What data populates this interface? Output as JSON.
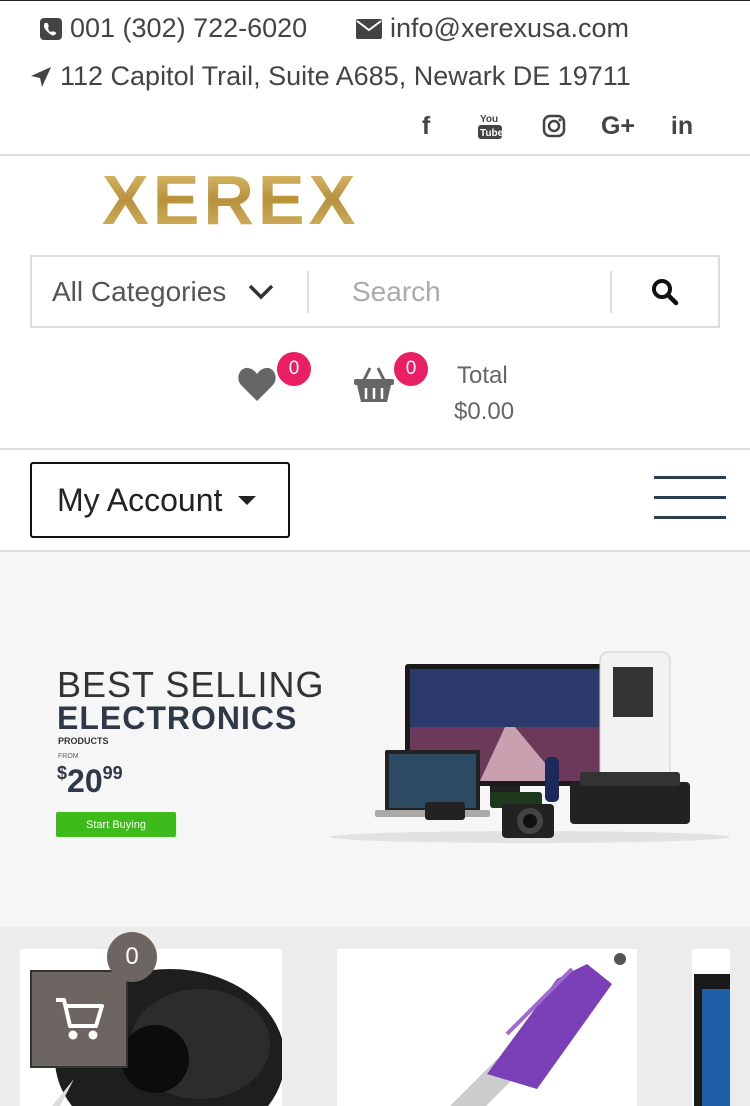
{
  "topbar": {
    "phone": "001 (302) 722-6020",
    "email": "info@xerexusa.com",
    "address": "112 Capitol Trail, Suite A685, Newark DE 19711",
    "social": [
      "facebook-icon",
      "youtube-icon",
      "instagram-icon",
      "google-plus-icon",
      "linkedin-icon"
    ],
    "social_glyphs": {
      "facebook": "f",
      "gplus": "G+",
      "linkedin": "in"
    }
  },
  "logo": {
    "text": "XEREX",
    "color": "#c9a24a"
  },
  "search": {
    "category": "All Categories",
    "placeholder": "Search"
  },
  "header": {
    "wishlist_count": "0",
    "cart_count": "0",
    "total_label": "Total",
    "total_value": "$0.00",
    "badge_color": "#e91e63"
  },
  "nav": {
    "account_label": "My Account"
  },
  "banner": {
    "line1": "BEST SELLING",
    "line2": "ELECTRONICS",
    "line3": "PRODUCTS",
    "from": "FROM",
    "currency": "$",
    "price_int": "20",
    "price_dec": "99",
    "cta": "Start Buying",
    "cta_color": "#3dbb1a"
  },
  "floating_cart": {
    "count": "0"
  }
}
